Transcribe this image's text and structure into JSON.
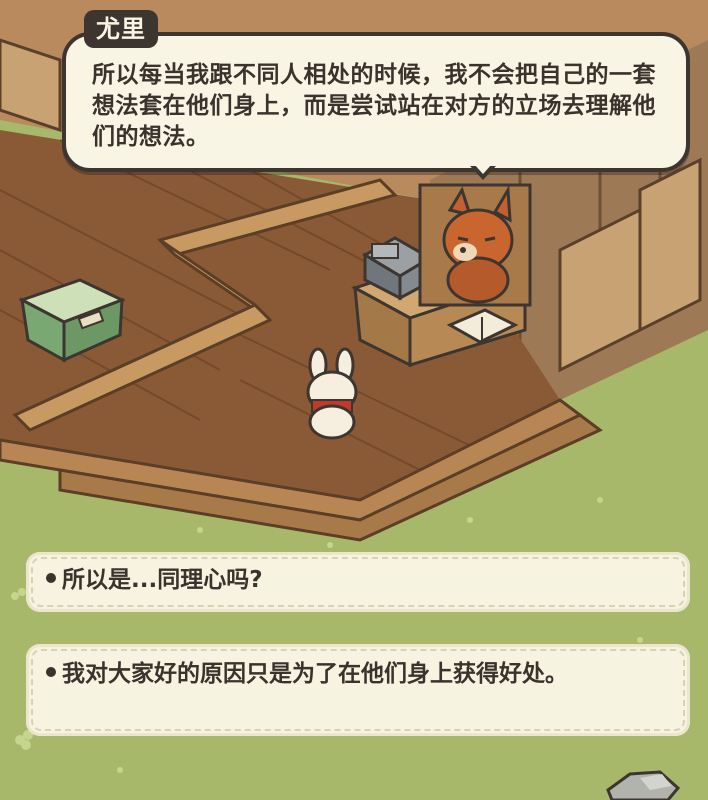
{
  "dialogue": {
    "speaker": "尤里",
    "text": "所以每当我跟不同人相处的时候，我不会把自己的一套想法套在他们身上，而是尝试站在对方的立场去理解他们的想法。"
  },
  "choices": [
    {
      "text": "所以是...同理心吗?"
    },
    {
      "text": "我对大家好的原因只是为了在他们身上获得好处。"
    }
  ],
  "colors": {
    "grass": "#a7b86a",
    "wood_floor": "#8a5a36",
    "bubble_bg": "#f8f5e4",
    "outline": "#3d3530"
  }
}
